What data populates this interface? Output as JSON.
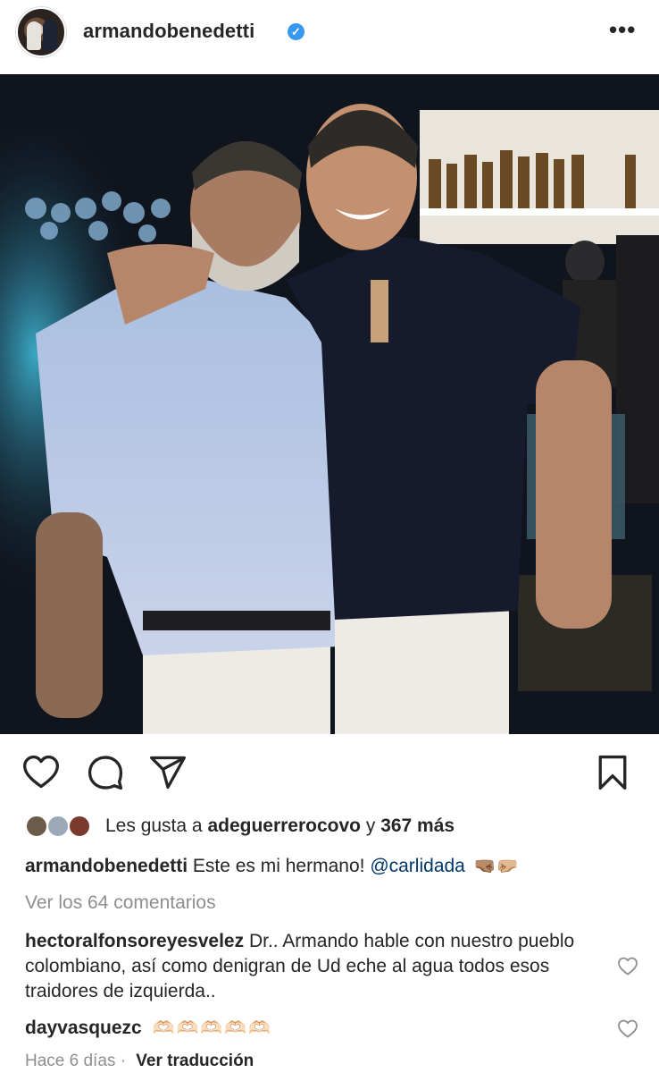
{
  "header": {
    "username": "armandobenedetti",
    "verified_icon": "verified-badge-icon",
    "more_label": "•••"
  },
  "photo": {
    "description_icon": "post-photo"
  },
  "actions": {
    "like_icon": "heart-icon",
    "comment_icon": "comment-icon",
    "share_icon": "send-icon",
    "save_icon": "bookmark-icon"
  },
  "likes": {
    "prefix": "Les gusta a",
    "user": "adeguerrerocovo",
    "connector": "y",
    "count": "367 más"
  },
  "caption": {
    "author": "armandobenedetti",
    "text": "Este es mi hermano!",
    "mention": "@carlidada",
    "emoji": "🤜🏽🤛🏼"
  },
  "view_comments": "Ver los 64 comentarios",
  "comments": [
    {
      "author": "hectoralfonsoreyesvelez",
      "text": "Dr.. Armando hable con nuestro pueblo colombiano, así como denigran de Ud eche al agua todos esos traidores de izquierda.."
    },
    {
      "author": "dayvasquezc",
      "text": "🫶🏻🫶🏻🫶🏻🫶🏻🫶🏻"
    }
  ],
  "footer": {
    "time": "Hace 6 días",
    "separator": "·",
    "translate": "Ver traducción"
  },
  "colors": {
    "text": "#262626",
    "muted": "#8e8e8e",
    "mention": "#00376b",
    "verified": "#3897f0"
  }
}
